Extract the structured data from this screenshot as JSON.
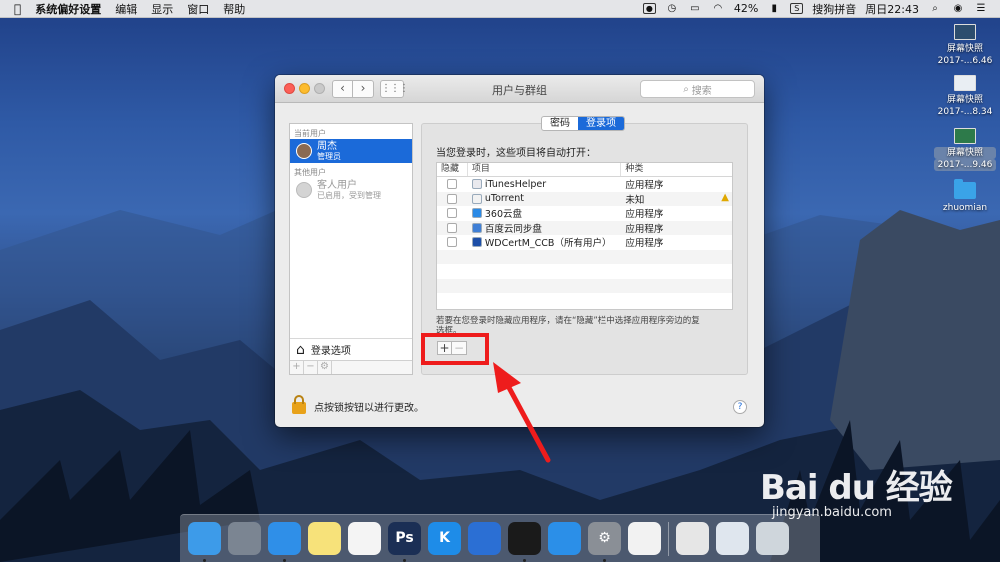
{
  "menubar": {
    "apple_icon": "apple-icon",
    "app_name": "系统偏好设置",
    "menus": [
      "编辑",
      "显示",
      "窗口",
      "帮助"
    ],
    "battery": "42%",
    "input_method": "搜狗拼音",
    "clock": "周日22:43"
  },
  "desktop": {
    "icons": [
      {
        "line1": "屏幕快照",
        "line2": "2017-...6.46"
      },
      {
        "line1": "屏幕快照",
        "line2": "2017-...8.34"
      },
      {
        "line1": "屏幕快照",
        "line2": "2017-...9.46"
      },
      {
        "line1": "zhuomian",
        "line2": ""
      }
    ]
  },
  "window": {
    "title": "用户与群组",
    "search_placeholder": "搜索",
    "nav_back": "‹",
    "nav_forward": "›",
    "grid_glyph": "⋮⋮⋮",
    "userlist": {
      "current_label": "当前用户",
      "current_user": {
        "name": "周杰",
        "role": "管理员"
      },
      "other_label": "其他用户",
      "guest_user": {
        "name": "客人用户",
        "status": "已启用，受到管理"
      },
      "login_options": "登录选项",
      "buttons": [
        "+",
        "−",
        "⚙"
      ]
    },
    "tabs": {
      "password": "密码",
      "login_items": "登录项"
    },
    "login_heading": "当您登录时，这些项目将自动打开：",
    "table": {
      "headers": {
        "hide": "隐藏",
        "item": "项目",
        "kind": "种类"
      },
      "rows": [
        {
          "name": "iTunesHelper",
          "kind": "应用程序",
          "icon_color": "#e9e9ee",
          "warn": false
        },
        {
          "name": "uTorrent",
          "kind": "未知",
          "icon_color": "#f2f2f2",
          "warn": true
        },
        {
          "name": "360云盘",
          "kind": "应用程序",
          "icon_color": "#2a8ae6",
          "warn": false
        },
        {
          "name": "百度云同步盘",
          "kind": "应用程序",
          "icon_color": "#3f7fd6",
          "warn": false
        },
        {
          "name": "WDCertM_CCB（所有用户）",
          "kind": "应用程序",
          "icon_color": "#1d4fa8",
          "warn": false
        }
      ]
    },
    "hint": "若要在您登录时隐藏应用程序，请在“隐藏”栏中选择应用程序旁边的复选框。",
    "add_label": "+",
    "remove_label": "−",
    "lock_text": "点按锁按钮以进行更改。",
    "help_label": "?"
  },
  "dock": {
    "apps": [
      {
        "name": "finder-icon",
        "color": "#3d9be9",
        "glyph": ""
      },
      {
        "name": "launchpad-icon",
        "color": "#7b8592",
        "glyph": ""
      },
      {
        "name": "safari-icon",
        "color": "#2f8fe8",
        "glyph": ""
      },
      {
        "name": "notes-icon",
        "color": "#f7e27a",
        "glyph": ""
      },
      {
        "name": "reminders-icon",
        "color": "#f4f4f4",
        "glyph": ""
      },
      {
        "name": "photoshop-icon",
        "color": "#1b2f55",
        "glyph": "Ps"
      },
      {
        "name": "kugou-icon",
        "color": "#1e8ce8",
        "glyph": "K"
      },
      {
        "name": "keynote-icon",
        "color": "#2b6fd4",
        "glyph": ""
      },
      {
        "name": "qq-icon",
        "color": "#1a1a1a",
        "glyph": ""
      },
      {
        "name": "appstore-icon",
        "color": "#2b8fe8",
        "glyph": ""
      },
      {
        "name": "system-preferences-icon",
        "color": "#8a8f96",
        "glyph": "⚙"
      },
      {
        "name": "numbers-icon",
        "color": "#f2f2f2",
        "glyph": ""
      }
    ],
    "right": [
      {
        "name": "preview-icon",
        "color": "#e6e6e6",
        "glyph": ""
      },
      {
        "name": "mail-icon",
        "color": "#dfe6ee",
        "glyph": ""
      },
      {
        "name": "trash-icon",
        "color": "#cfd6dc",
        "glyph": ""
      }
    ]
  },
  "watermark": {
    "logo": "Bai du 经验",
    "url": "jingyan.baidu.com"
  }
}
